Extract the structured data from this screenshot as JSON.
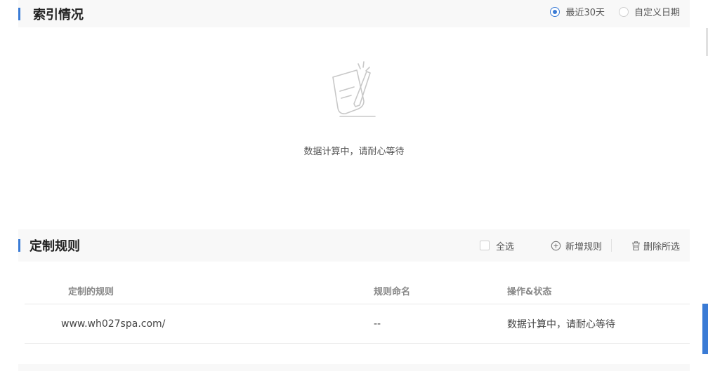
{
  "index_section": {
    "title": "索引情况",
    "range_options": [
      {
        "label": "最近30天",
        "checked": true
      },
      {
        "label": "自定义日期",
        "checked": false
      }
    ],
    "empty_message": "数据计算中，请耐心等待"
  },
  "rules_section": {
    "title": "定制规则",
    "select_all_label": "全选",
    "add_rule_label": "新增规则",
    "delete_selected_label": "删除所选",
    "columns": [
      "定制的规则",
      "规则命名",
      "操作&状态"
    ],
    "rows": [
      {
        "rule": "www.wh027spa.com/",
        "name": "--",
        "status": "数据计算中，请耐心等待"
      }
    ]
  },
  "colors": {
    "accent": "#3a7bd5"
  }
}
